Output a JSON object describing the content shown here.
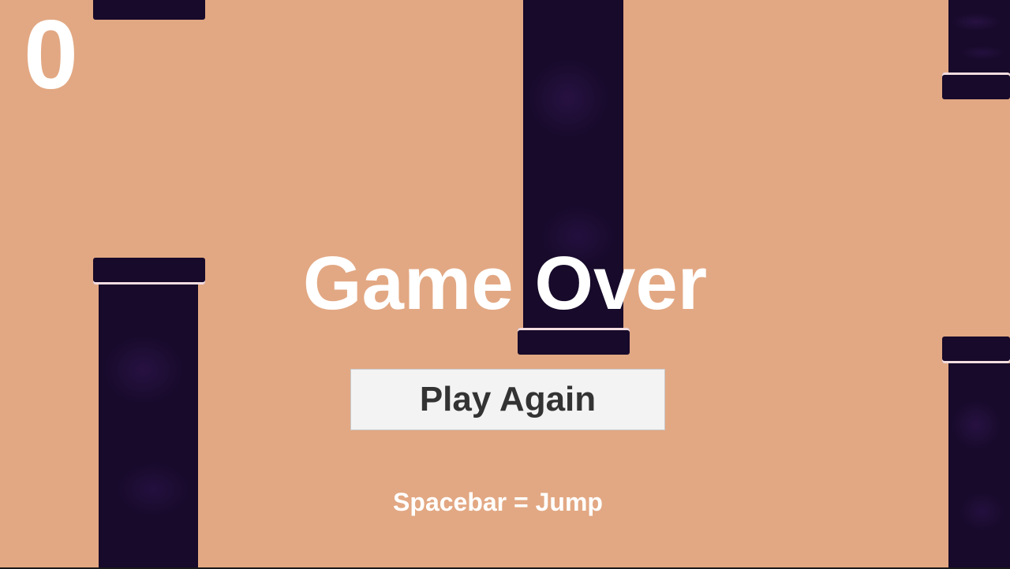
{
  "game": {
    "score": "0",
    "title": "Game Over",
    "play_again_label": "Play Again",
    "controls_hint": "Spacebar = Jump"
  },
  "colors": {
    "sky": "#e2a883",
    "pipe": "#170a2a",
    "pipe_rim": "#f3dde0",
    "text": "#ffffff",
    "button_background": "#f3f3f3",
    "button_text": "#333333"
  }
}
